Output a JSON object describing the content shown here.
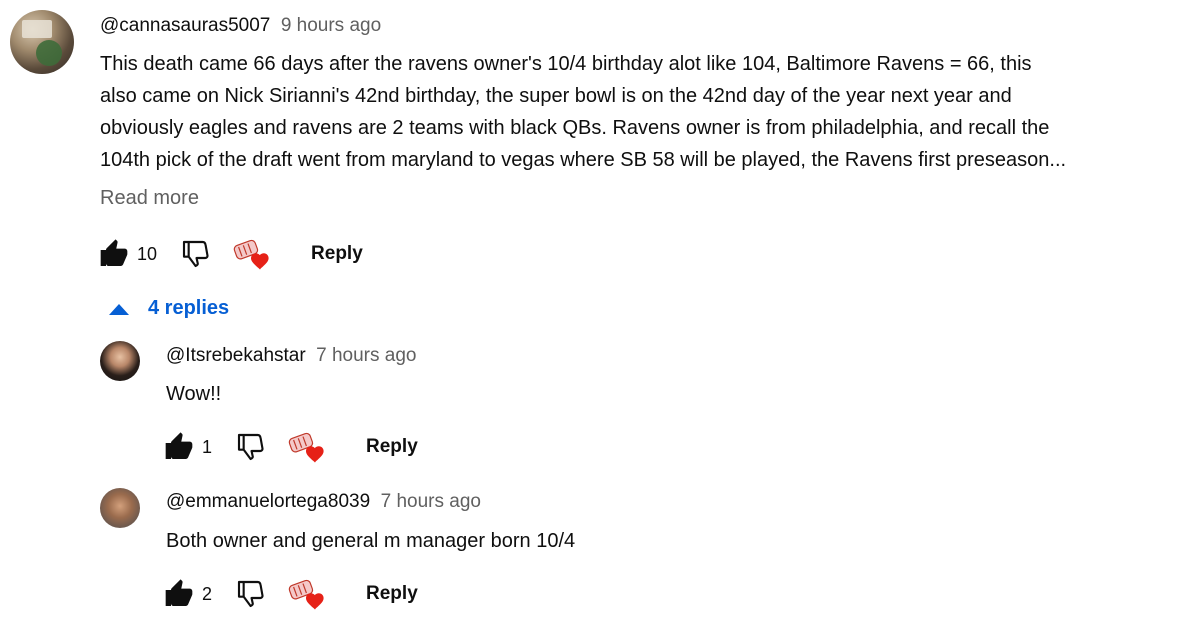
{
  "main_comment": {
    "author": "@cannasauras5007",
    "time": "9 hours ago",
    "text_lines": [
      "This death came 66 days after the ravens owner's 10/4 birthday alot like 104, Baltimore Ravens = 66, this",
      "also came on Nick Sirianni's 42nd birthday, the super bowl is on the 42nd day of the year next year and",
      "obviously eagles and ravens are 2 teams with black QBs. Ravens owner is from philadelphia, and recall the",
      "104th pick of the draft went from maryland to vegas where SB 58 will be played, the Ravens first preseason..."
    ],
    "read_more": "Read more",
    "likes": "10",
    "reply_label": "Reply"
  },
  "replies_toggle": {
    "label": "4 replies",
    "icon": "chevron-up-icon",
    "color": "#065fd4"
  },
  "replies": [
    {
      "author": "@Itsrebekahstar",
      "time": "7 hours ago",
      "text": "Wow!!",
      "likes": "1",
      "reply_label": "Reply"
    },
    {
      "author": "@emmanuelortega8039",
      "time": "7 hours ago",
      "text": "Both owner and general m manager born 10/4",
      "likes": "2",
      "reply_label": "Reply"
    }
  ],
  "icons": {
    "like": "thumbs-up-icon",
    "dislike": "thumbs-down-icon",
    "creator_heart": "creator-heart-icon"
  },
  "colors": {
    "text": "#0f0f0f",
    "secondary": "#606060",
    "link": "#065fd4",
    "heart": "#e62117"
  }
}
